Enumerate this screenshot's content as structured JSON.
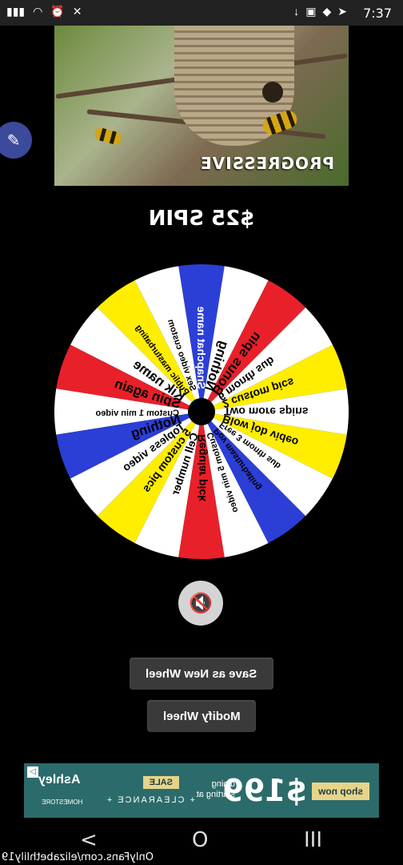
{
  "status_bar": {
    "time": "7:37",
    "left_icons": [
      "signal-icon",
      "wifi-icon",
      "alarm-icon",
      "mute-icon"
    ],
    "right_icons": [
      "download-icon",
      "image-icon",
      "notification-icon",
      "send-icon"
    ]
  },
  "banner": {
    "text": "PROGRESSIVE"
  },
  "spin_title": "$25 SPIN",
  "wheel": {
    "segments": [
      {
        "label": "Snapchat name",
        "color": "#2b3fd6",
        "text": "#ffffff"
      },
      {
        "label": "Sex video custom",
        "color": "#ffffff",
        "text": "#000000"
      },
      {
        "label": "Public masturbating",
        "color": "#ffee00",
        "text": "#000000"
      },
      {
        "label": "Kik name",
        "color": "#ffffff",
        "text": "#000000"
      },
      {
        "label": "Spin again",
        "color": "#e8202a",
        "text": "#000000"
      },
      {
        "label": "Custom 1 min video",
        "color": "#ffffff",
        "text": "#000000"
      },
      {
        "label": "Nothing",
        "color": "#2b3fd6",
        "text": "#000000"
      },
      {
        "label": "Topless video",
        "color": "#ffffff",
        "text": "#000000"
      },
      {
        "label": "5 custom pics",
        "color": "#ffee00",
        "text": "#000000"
      },
      {
        "label": "Cell number",
        "color": "#ffffff",
        "text": "#000000"
      },
      {
        "label": "Regular pick",
        "color": "#e8202a",
        "text": "#000000"
      },
      {
        "label": "Custom 5 min video",
        "color": "#ffffff",
        "text": "#000000"
      },
      {
        "label": "Pov masturbating",
        "color": "#2b3fd6",
        "text": "#000000"
      },
      {
        "label": "Free 3 month sub",
        "color": "#ffffff",
        "text": "#000000"
      },
      {
        "label": "Blow job video",
        "color": "#ffee00",
        "text": "#000000"
      },
      {
        "label": "Two more spins",
        "color": "#ffffff",
        "text": "#000000"
      },
      {
        "label": "2 custom pics",
        "color": "#ffee00",
        "text": "#000000"
      },
      {
        "label": "6 month sub",
        "color": "#ffffff",
        "text": "#000000"
      },
      {
        "label": "Bonus spin",
        "color": "#e8202a",
        "text": "#000000"
      },
      {
        "label": "Nothing",
        "color": "#ffffff",
        "text": "#000000"
      }
    ]
  },
  "buttons": {
    "save": "Save as New Wheel",
    "modify": "Modify Wheel"
  },
  "ad": {
    "shop_label": "shop now",
    "price": "$199",
    "dining_line1": "dining",
    "dining_line2": "starting at",
    "sale": "SALE",
    "clearance": "+ CLEARANCE +",
    "brand": "Ashley",
    "brand_sub": "HOMESTORE"
  },
  "nav": {
    "back": "<",
    "home": "O",
    "recents": "III"
  },
  "watermark": "OnlyFans.com/elizabethlily19"
}
